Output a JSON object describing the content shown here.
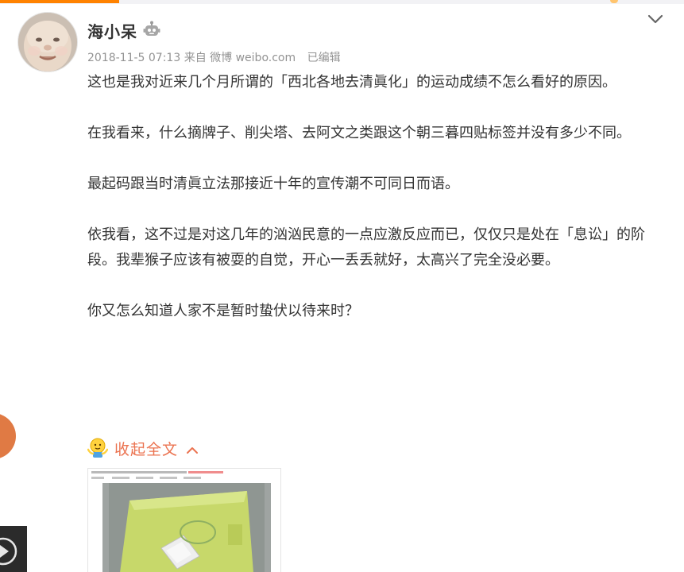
{
  "post": {
    "author": "海小呆",
    "date": "2018-11-5 07:13",
    "source": "来自 微博 weibo.com",
    "edited": "已编辑",
    "paragraphs": [
      "这也是我对近来几个月所谓的「西北各地去清眞化」的运动成绩不怎么看好的原因。",
      "在我看来，什么摘牌子、削尖塔、去阿文之类跟这个朝三暮四贴标签并没有多少不同。",
      "最起码跟当时清眞立法那接近十年的宣传潮不可同日而语。",
      "依我看，这不过是对这几年的汹汹民意的一点应激反应而已，仅仅只是处在「息讼」的阶段。我辈猴子应该有被耍的自觉，开心一丢丢就好，太高兴了完全没必要。",
      "你又怎么知道人家不是暂时蛰伏以待来时？"
    ],
    "collapse_label": "收起全文"
  },
  "icons": {
    "author_badge": "robot-icon",
    "menu": "chevron-down-icon",
    "collapse_emoji": "shrug-emoji-icon",
    "collapse_arrow": "chevron-up-icon"
  },
  "colors": {
    "accent_orange": "#ff8200",
    "link_orange": "#eb7350",
    "text": "#333333",
    "meta": "#939393"
  }
}
